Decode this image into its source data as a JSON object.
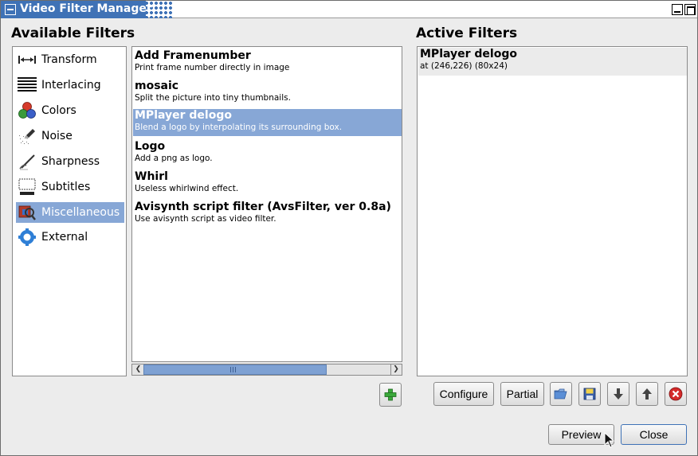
{
  "window": {
    "title": "Video Filter Manager"
  },
  "available": {
    "heading": "Available Filters",
    "categories": [
      {
        "label": "Transform",
        "icon": "transform-icon"
      },
      {
        "label": "Interlacing",
        "icon": "interlacing-icon"
      },
      {
        "label": "Colors",
        "icon": "colors-icon"
      },
      {
        "label": "Noise",
        "icon": "noise-icon"
      },
      {
        "label": "Sharpness",
        "icon": "sharpness-icon"
      },
      {
        "label": "Subtitles",
        "icon": "subtitles-icon"
      },
      {
        "label": "Miscellaneous",
        "icon": "miscellaneous-icon",
        "selected": true
      },
      {
        "label": "External",
        "icon": "external-icon"
      }
    ],
    "filters": [
      {
        "name": "Add Framenumber",
        "desc": "Print frame number directly in image"
      },
      {
        "name": "mosaic",
        "desc": "Split the picture into tiny thumbnails."
      },
      {
        "name": "MPlayer delogo",
        "desc": "Blend a logo by interpolating its surrounding box.",
        "selected": true
      },
      {
        "name": "Logo",
        "desc": "Add a png as logo."
      },
      {
        "name": "Whirl",
        "desc": "Useless whirlwind effect."
      },
      {
        "name": "Avisynth script filter (AvsFilter, ver 0.8a)",
        "desc": "Use avisynth script as video filter."
      }
    ]
  },
  "active": {
    "heading": "Active Filters",
    "items": [
      {
        "name": "MPlayer delogo",
        "desc": "at (246,226) (80x24)"
      }
    ]
  },
  "buttons": {
    "configure": "Configure",
    "partial": "Partial",
    "preview": "Preview",
    "close": "Close"
  },
  "colors": {
    "title_bar": "#3f72b6",
    "selection": "#87a7d6",
    "remove": "#d42a2a",
    "add": "#3aa83a"
  }
}
